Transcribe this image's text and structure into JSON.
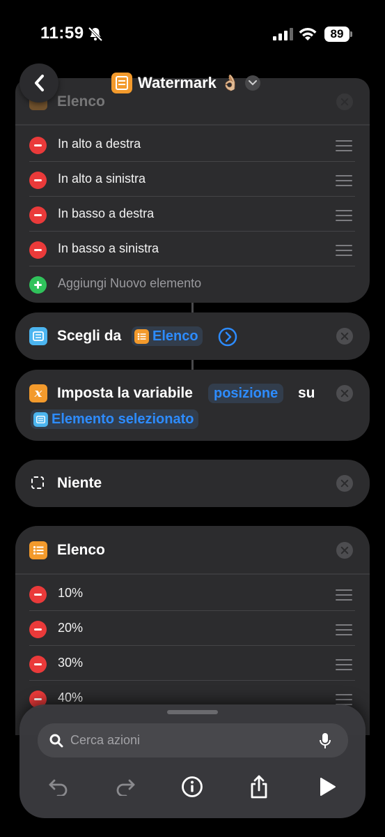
{
  "status": {
    "time": "11:59",
    "battery": "89"
  },
  "header": {
    "title": "Watermark 👌🏼",
    "faded_list_title": "Elenco"
  },
  "list1": {
    "items": [
      "In alto a destra",
      "In alto a sinistra",
      "In basso a destra",
      "In basso a sinistra"
    ],
    "add_label": "Aggiungi Nuovo elemento"
  },
  "choose": {
    "prefix": "Scegli da",
    "token": "Elenco"
  },
  "setvar": {
    "prefix": "Imposta la variabile",
    "var": "posizione",
    "su": "su",
    "value": "Elemento selezionato"
  },
  "nothing": {
    "label": "Niente"
  },
  "list2": {
    "title": "Elenco",
    "items": [
      "10%",
      "20%",
      "30%",
      "40%"
    ]
  },
  "bottom": {
    "search_placeholder": "Cerca azioni"
  },
  "colors": {
    "accent": "#2d8cff",
    "orange": "#f39a2c",
    "red": "#ea3a3a",
    "green": "#30c25b",
    "card": "#2c2c2e"
  }
}
